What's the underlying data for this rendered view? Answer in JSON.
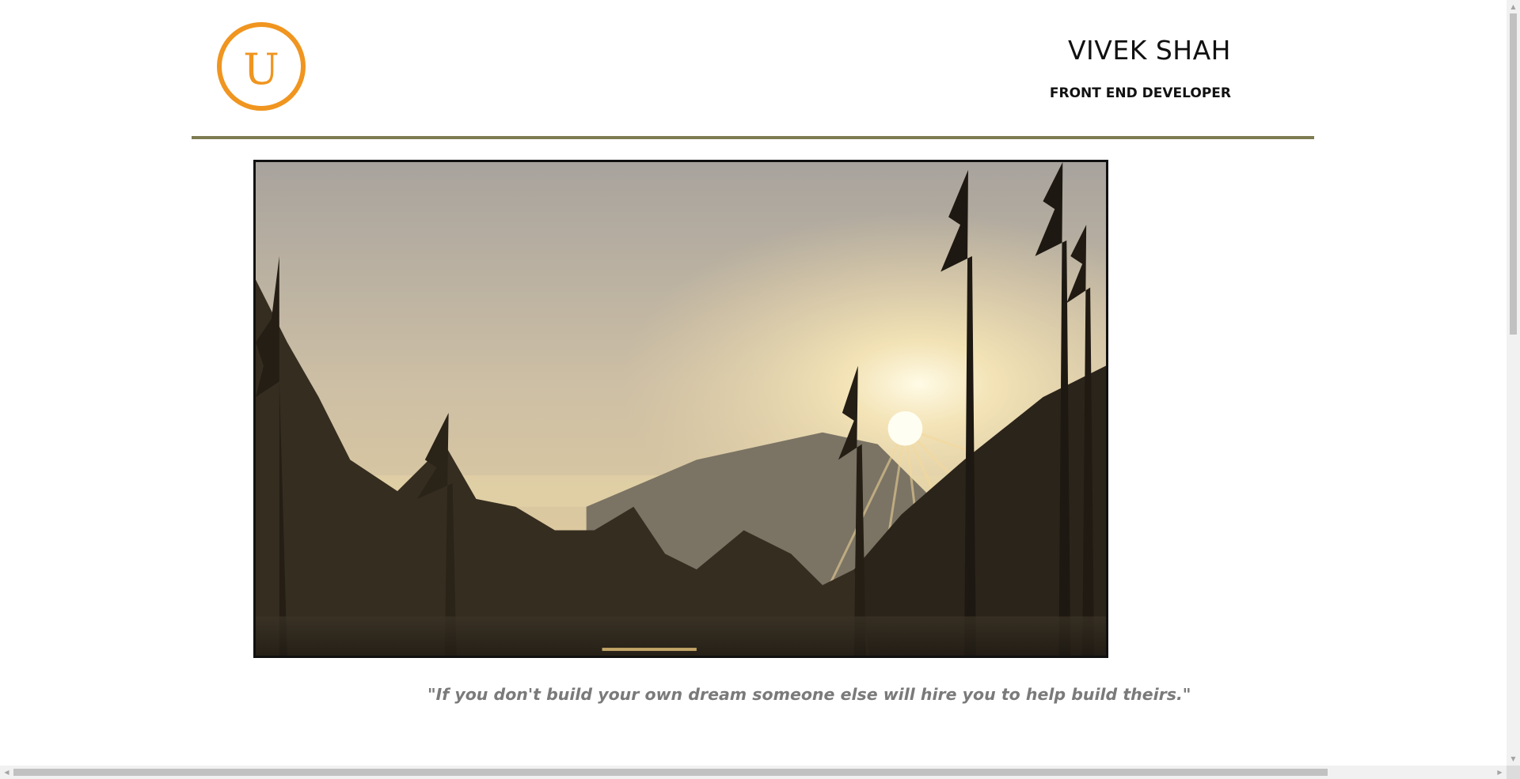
{
  "header": {
    "logo_letter": "U",
    "name": "VIVEK SHAH",
    "role": "FRONT END DEVELOPER"
  },
  "hero": {
    "image_subject": "sunset-over-pine-forest"
  },
  "quote": {
    "text": "\"If you don't build your own dream someone else will hire you to help build theirs.\""
  },
  "colors": {
    "accent": "#f0951f",
    "divider": "#7d7c52",
    "text": "#111111",
    "quote": "#7a7a7a"
  },
  "scrollbars": {
    "up_glyph": "▲",
    "down_glyph": "▼",
    "left_glyph": "◀",
    "right_glyph": "▶"
  }
}
